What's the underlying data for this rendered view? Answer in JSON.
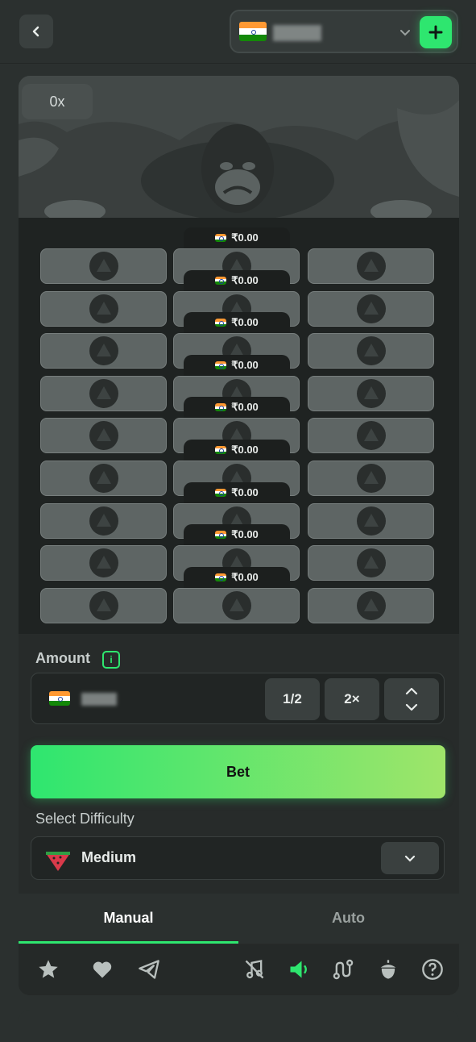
{
  "header": {
    "back_icon": "chevron-left-icon",
    "wallet": {
      "currency_flag": "india-flag-icon",
      "dropdown_icon": "chevron-down-icon",
      "add_icon": "plus-icon"
    }
  },
  "game": {
    "multiplier": "0x",
    "row_payout": "₹0.00",
    "rows": 9,
    "columns": 3
  },
  "bet_panel": {
    "amount_label": "Amount",
    "info_icon_text": "i",
    "half_label": "1/2",
    "double_label": "2×",
    "bet_label": "Bet"
  },
  "difficulty": {
    "label": "Select Difficulty",
    "selected": "Medium",
    "icon": "watermelon-icon"
  },
  "tabs": [
    {
      "label": "Manual",
      "active": true
    },
    {
      "label": "Auto",
      "active": false
    }
  ],
  "toolbar": {
    "icons": [
      "star-icon",
      "heart-icon",
      "telegram-icon",
      "music-off-icon",
      "sound-on-icon",
      "route-icon",
      "acorn-icon",
      "help-icon"
    ]
  },
  "colors": {
    "accent": "#2ee66f",
    "background": "#2b302f",
    "panel": "#272b2a"
  }
}
